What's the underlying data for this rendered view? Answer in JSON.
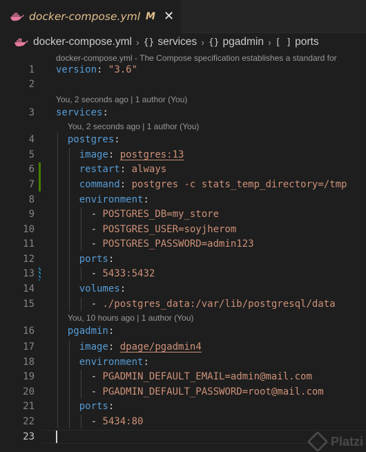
{
  "tab": {
    "filename": "docker-compose.yml",
    "modified_marker": "M",
    "close_glyph": "✕"
  },
  "breadcrumb": {
    "items": [
      "docker-compose.yml",
      "services",
      "pgadmin",
      "ports"
    ],
    "symbols": [
      "{}",
      "{}",
      "[ ]"
    ],
    "separator": "›"
  },
  "editor": {
    "schema_hint": "docker-compose.yml - The Compose specification establishes a standard for",
    "codelens": [
      "You, 2 seconds ago | 1 author (You)",
      "You, 2 seconds ago | 1 author (You)",
      "You, 10 hours ago | 1 author (You)"
    ],
    "lines": [
      {
        "n": "1",
        "indent": "",
        "key": "version",
        "value": "\"3.6\""
      },
      {
        "n": "2",
        "indent": "",
        "key": "",
        "value": ""
      },
      {
        "n": "3",
        "indent": "",
        "key": "services",
        "value": ""
      },
      {
        "n": "4",
        "indent": "  ",
        "key": "postgres",
        "value": ""
      },
      {
        "n": "5",
        "indent": "    ",
        "key": "image",
        "value": "postgres:13"
      },
      {
        "n": "6",
        "indent": "    ",
        "key": "restart",
        "value": "always"
      },
      {
        "n": "7",
        "indent": "    ",
        "key": "command",
        "value": "postgres -c stats_temp_directory=/tmp"
      },
      {
        "n": "8",
        "indent": "    ",
        "key": "environment",
        "value": ""
      },
      {
        "n": "9",
        "indent": "      ",
        "key": "",
        "value": "- POSTGRES_DB=my_store"
      },
      {
        "n": "10",
        "indent": "      ",
        "key": "",
        "value": "- POSTGRES_USER=soyjherom"
      },
      {
        "n": "11",
        "indent": "      ",
        "key": "",
        "value": "- POSTGRES_PASSWORD=admin123"
      },
      {
        "n": "12",
        "indent": "    ",
        "key": "ports",
        "value": ""
      },
      {
        "n": "13",
        "indent": "      ",
        "key": "",
        "value": "- 5433:5432"
      },
      {
        "n": "14",
        "indent": "    ",
        "key": "volumes",
        "value": ""
      },
      {
        "n": "15",
        "indent": "      ",
        "key": "",
        "value": "- ./postgres_data:/var/lib/postgresql/data"
      },
      {
        "n": "16",
        "indent": "  ",
        "key": "pgadmin",
        "value": ""
      },
      {
        "n": "17",
        "indent": "    ",
        "key": "image",
        "value": "dpage/pgadmin4"
      },
      {
        "n": "18",
        "indent": "    ",
        "key": "environment",
        "value": ""
      },
      {
        "n": "19",
        "indent": "      ",
        "key": "",
        "value": "- PGADMIN_DEFAULT_EMAIL=admin@mail.com"
      },
      {
        "n": "20",
        "indent": "      ",
        "key": "",
        "value": "- PGADMIN_DEFAULT_PASSWORD=root@mail.com"
      },
      {
        "n": "21",
        "indent": "    ",
        "key": "ports",
        "value": ""
      },
      {
        "n": "22",
        "indent": "      ",
        "key": "",
        "value": "- 5434:80"
      },
      {
        "n": "23",
        "indent": "",
        "key": "",
        "value": ""
      }
    ]
  },
  "watermark": {
    "text": "Platzi"
  },
  "colors": {
    "background": "#1e1e1e",
    "key": "#569cd6",
    "string": "#ce9178",
    "modified": "#e2c08d",
    "added_bar": "#487e02",
    "modified_bar": "#1b81a8"
  }
}
